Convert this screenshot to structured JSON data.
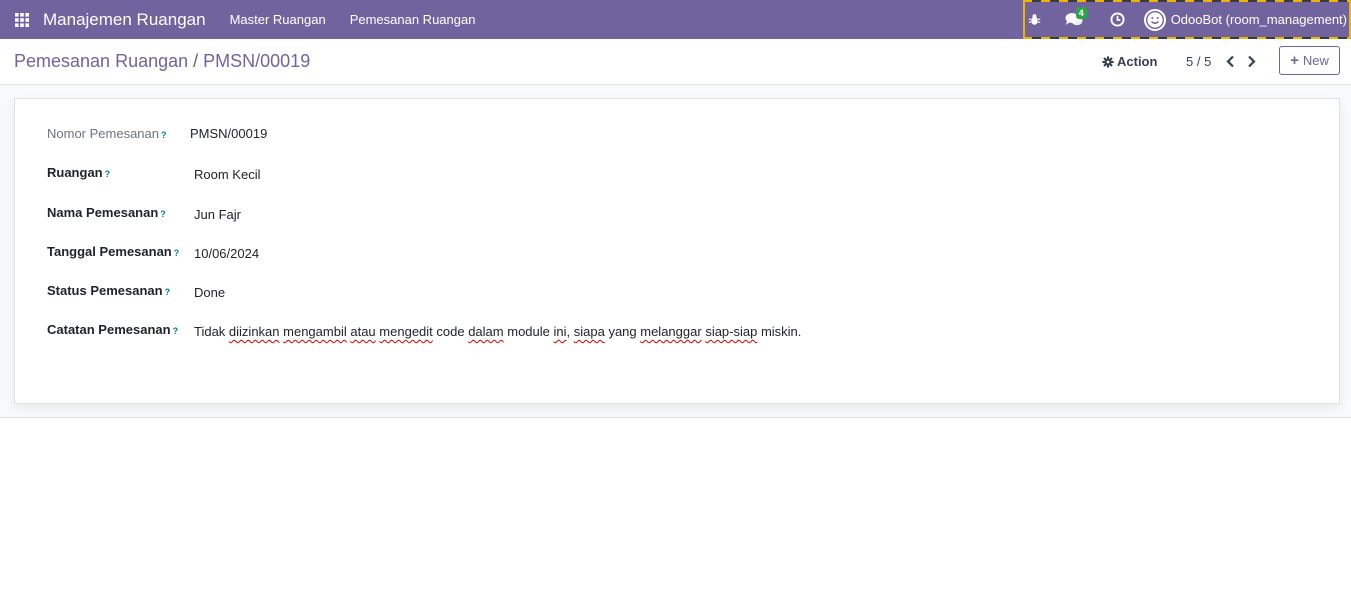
{
  "navbar": {
    "app_name": "Manajemen Ruangan",
    "menus": [
      "Master Ruangan",
      "Pemesanan Ruangan"
    ],
    "chat_badge": "4",
    "user_name": "OdooBot (room_management)",
    "colors": {
      "bar": "#71639e",
      "badge": "#28a745",
      "debug_stripe": "#f0b400"
    },
    "icons": [
      "apps-grid-icon",
      "bug-icon",
      "chat-icon",
      "clock-icon",
      "user-avatar"
    ]
  },
  "control_panel": {
    "breadcrumb_parent": "Pemesanan Ruangan",
    "breadcrumb_separator": "/",
    "breadcrumb_current": "PMSN/00019",
    "action_label": "Action",
    "pager": "5 / 5",
    "new_label": "New"
  },
  "form": {
    "help_mark": "?",
    "nomor": {
      "label": "Nomor Pemesanan",
      "value": "PMSN/00019"
    },
    "ruangan": {
      "label": "Ruangan",
      "value": "Room Kecil"
    },
    "nama": {
      "label": "Nama Pemesanan",
      "value": "Jun Fajr"
    },
    "tanggal": {
      "label": "Tanggal Pemesanan",
      "value": "10/06/2024"
    },
    "status": {
      "label": "Status Pemesanan",
      "value": "Done"
    },
    "catatan": {
      "label": "Catatan Pemesanan",
      "value_parts": [
        "Tidak ",
        "diizinkan",
        " ",
        "mengambil",
        " ",
        "atau",
        " ",
        "mengedit",
        " code ",
        "dalam",
        " module ",
        "ini",
        ", ",
        "siapa",
        " yang ",
        "melanggar",
        " ",
        "siap-siap",
        " miskin."
      ]
    }
  }
}
